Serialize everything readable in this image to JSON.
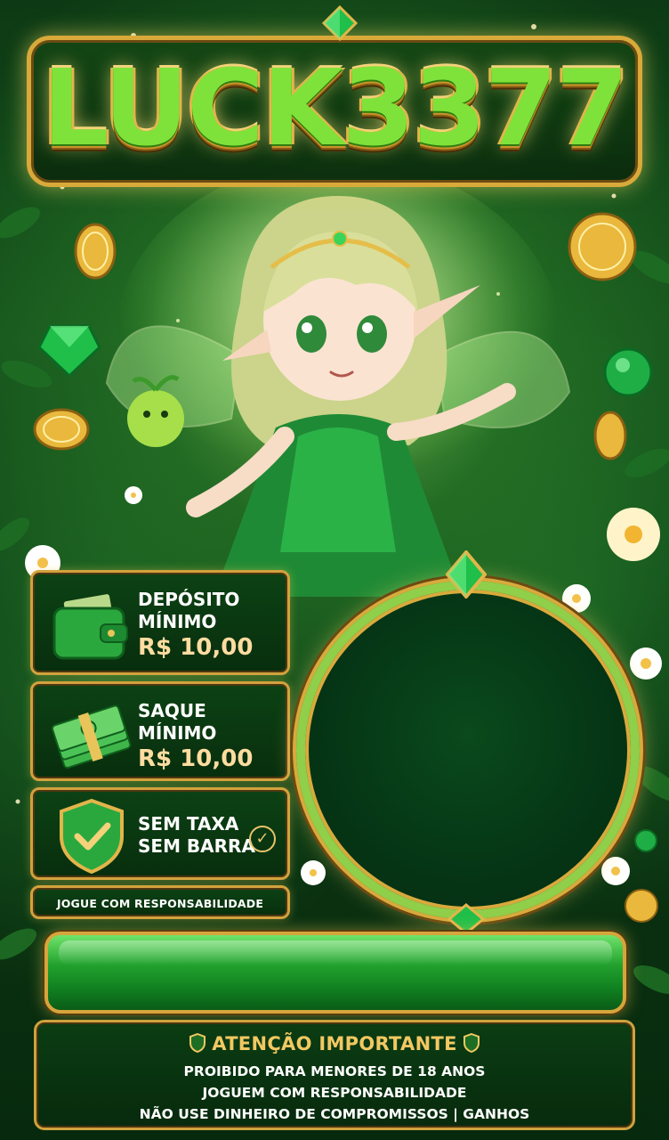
{
  "header": {
    "logo_text": "LUCK3377"
  },
  "cards": [
    {
      "line1": "DEPÓSITO",
      "line2": "MÍNIMO",
      "amount": "R$ 10,00",
      "icon": "wallet-icon"
    },
    {
      "line1": "SAQUE",
      "line2": "MÍNIMO",
      "amount": "R$ 10,00",
      "icon": "cash-stack-icon"
    },
    {
      "line1": "SEM TAXA",
      "line2": "SEM BARRA",
      "icon": "shield-check-icon",
      "badge_icon": "check-circle-icon"
    }
  ],
  "responsible_label": "JOGUE COM RESPONSABILIDADE",
  "notice": {
    "title": "ATENÇÃO IMPORTANTE",
    "lines": [
      "PROIBIDO PARA MENORES DE 18 ANOS",
      "JOGUEM COM RESPONSABILIDADE",
      "NÃO USE DINHEIRO DE COMPROMISSOS | GANHOS"
    ]
  },
  "colors": {
    "accent_gold": "#d6a53c",
    "brand_green": "#22a12e",
    "dark_green": "#072a0d",
    "amount_text": "#ffdca0",
    "notice_title": "#f2c862"
  }
}
